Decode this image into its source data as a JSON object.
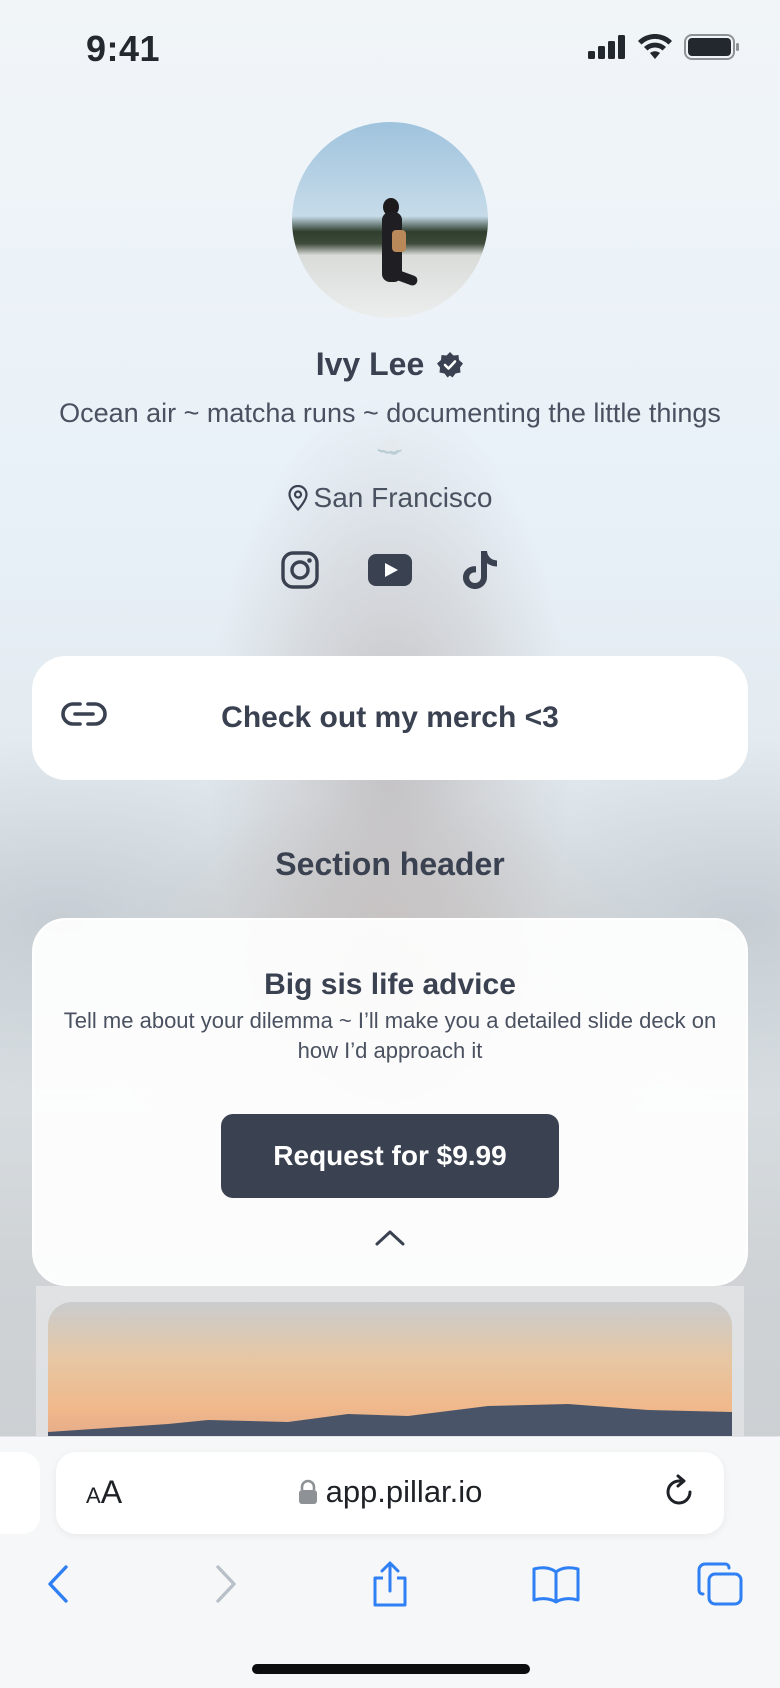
{
  "status_bar": {
    "time": "9:41",
    "icons": [
      "signal-icon",
      "wifi-icon",
      "battery-icon"
    ]
  },
  "profile": {
    "name": "Ivy Lee",
    "verified_icon": "verified-badge-icon",
    "bio": "Ocean air ~ matcha runs ~ documenting the little things",
    "bio_emoji": "☁️",
    "location": "San Francisco",
    "location_icon": "map-pin-icon",
    "socials": [
      "instagram-icon",
      "youtube-icon",
      "tiktok-icon"
    ]
  },
  "link_card": {
    "icon": "link-icon",
    "label": "Check out my merch <3"
  },
  "section": {
    "header": "Section header"
  },
  "product": {
    "title": "Big sis life advice",
    "description": "Tell me about your dilemma ~ I’ll make you a detailed slide deck on how I’d approach it",
    "button_label": "Request for $9.99",
    "collapse_icon": "chevron-up-icon"
  },
  "browser": {
    "text_size_label_small": "A",
    "text_size_label_large": "A",
    "lock_icon": "lock-icon",
    "url": "app.pillar.io",
    "reload_icon": "reload-icon",
    "toolbar": [
      "back-icon",
      "forward-icon",
      "share-icon",
      "bookmarks-icon",
      "tabs-icon"
    ]
  },
  "colors": {
    "text_dark": "#3a4150",
    "button_bg": "#3a4150",
    "browser_accent": "#2f7ff5",
    "browser_disabled": "#b9c0c8"
  }
}
